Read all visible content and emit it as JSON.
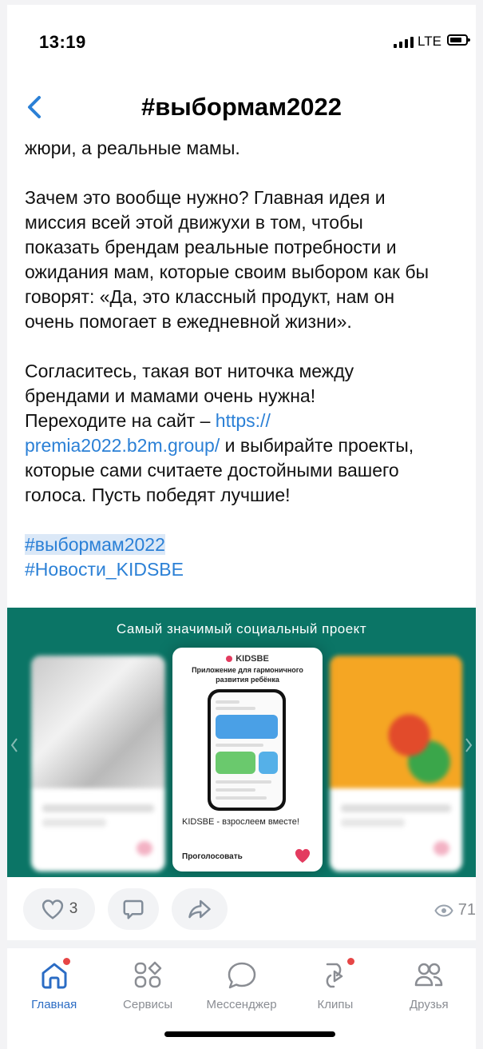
{
  "status_bar": {
    "time": "13:19",
    "network": "LTE"
  },
  "header": {
    "title": "#выбормам2022"
  },
  "post": {
    "p1": "жюри, а реальные мамы.",
    "p2_lines": [
      "Зачем это вообще нужно? Главная идея и",
      "миссия всей этой движухи в том, чтобы",
      "показать брендам реальные потребности и",
      "ожидания мам, которые своим выбором как бы",
      "говорят: «Да, это классный продукт, нам он",
      "очень помогает в ежедневной жизни»."
    ],
    "p3_lines": [
      "Согласитесь, такая вот ниточка между",
      "брендами и мамами очень нужна!"
    ],
    "p3_link_prefix": "Переходите на сайт – ",
    "link_part1": "https://",
    "link_part2": "premia2022.b2m.group/",
    "p3_after_link": " и выбирайте проекты,",
    "p3_tail_lines": [
      "которые сами считаете достойными вашего",
      "голоса. Пусть победят лучшие!"
    ],
    "hashtags": [
      "#выбормам2022",
      "#Новости_KIDSBE"
    ]
  },
  "image": {
    "caption": "Самый значимый социальный проект",
    "card_logo": "KIDSBE",
    "card_subtitle": "Приложение для гармоничного развития ребёнка",
    "card_text": "KIDSBE - взрослеем вместе!",
    "card_vote": "Проголосовать"
  },
  "actions": {
    "likes": "3",
    "views": "71"
  },
  "tabbar": {
    "items": [
      {
        "label": "Главная",
        "icon": "home-icon"
      },
      {
        "label": "Сервисы",
        "icon": "grid-icon"
      },
      {
        "label": "Мессенджер",
        "icon": "chat-bubble-icon"
      },
      {
        "label": "Клипы",
        "icon": "clips-icon"
      },
      {
        "label": "Друзья",
        "icon": "friends-icon"
      }
    ]
  },
  "colors": {
    "accent": "#2b80d6",
    "tab_active": "#2b6cc4",
    "image_bg": "#0b7566",
    "notify": "#e64646"
  }
}
